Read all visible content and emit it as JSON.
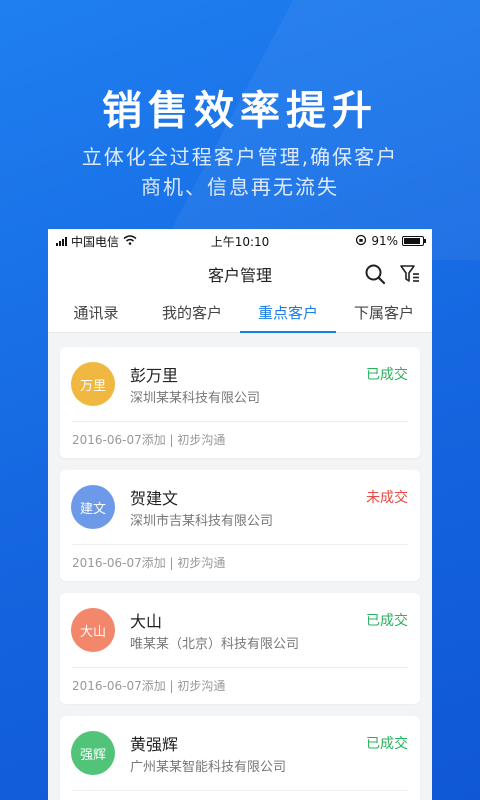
{
  "hero": {
    "title": "销售效率提升",
    "subtitle_line1": "立体化全过程客户管理,确保客户",
    "subtitle_line2": "商机、信息再无流失"
  },
  "status_bar": {
    "carrier": "中国电信",
    "time": "上午10:10",
    "battery": "91%",
    "battery_level": 0.91
  },
  "navbar": {
    "title": "客户管理",
    "icons": [
      "search-icon",
      "filter-icon"
    ]
  },
  "tabs": [
    {
      "label": "通讯录",
      "active": false
    },
    {
      "label": "我的客户",
      "active": false
    },
    {
      "label": "重点客户",
      "active": true
    },
    {
      "label": "下属客户",
      "active": false
    }
  ],
  "customers": [
    {
      "avatar": "万里",
      "avatar_color": "#f0b741",
      "name": "彭万里",
      "company": "深圳某某科技有限公司",
      "status": "已成交",
      "status_color": "#2bb25f",
      "meta": "2016-06-07添加 | 初步沟通"
    },
    {
      "avatar": "建文",
      "avatar_color": "#6d9ae8",
      "name": "贺建文",
      "company": "深圳市吉某科技有限公司",
      "status": "未成交",
      "status_color": "#e84b43",
      "meta": "2016-06-07添加 | 初步沟通"
    },
    {
      "avatar": "大山",
      "avatar_color": "#f2876b",
      "name": "大山",
      "company": "唯某某（北京）科技有限公司",
      "status": "已成交",
      "status_color": "#2bb25f",
      "meta": "2016-06-07添加 | 初步沟通"
    },
    {
      "avatar": "强辉",
      "avatar_color": "#52c47a",
      "name": "黄强辉",
      "company": "广州某某智能科技有限公司",
      "status": "已成交",
      "status_color": "#2bb25f",
      "meta": ""
    }
  ]
}
